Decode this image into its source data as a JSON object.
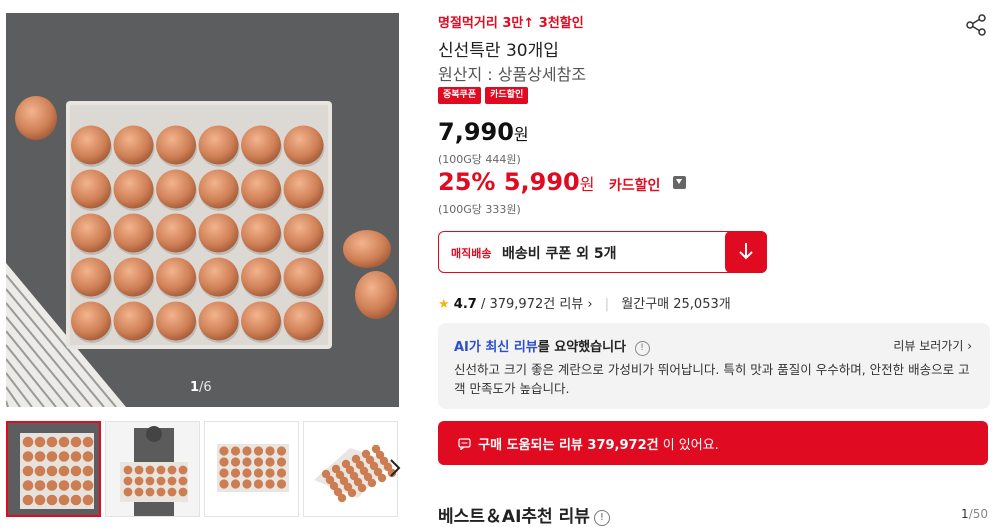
{
  "gallery": {
    "pager_current": "1",
    "pager_total": "/6",
    "next_icon": "chevron-right-icon"
  },
  "product": {
    "promo_text": "명절먹거리 3만",
    "promo_arrow": "↑",
    "promo_text2": "3천할인",
    "title": "신선특란 30개입",
    "origin": "원산지 : 상품상세참조",
    "badges": [
      "중복쿠폰",
      "카드할인"
    ],
    "price": "7,990",
    "price_unit": "원",
    "unit_price": "(100G당 444원)",
    "discount_rate": "25%",
    "sale_price": "5,990",
    "sale_unit": "원",
    "sale_label": "카드할인",
    "sale_unit_price": "(100G당 333원)"
  },
  "shipping": {
    "tag": "매직배송",
    "text": "배송비 쿠폰 외 5개",
    "button_icon": "arrow-down-icon"
  },
  "rating": {
    "score": "4.7",
    "reviews": "/ 379,972건 리뷰",
    "monthly": "월간구매 25,053개"
  },
  "ai_summary": {
    "head_blue": "AI가 최신 리뷰",
    "head_rest": "를 요약했습니다",
    "more": "리뷰 보러가기",
    "body": "신선하고 크기 좋은 계란으로 가성비가 뛰어납니다. 특히 맛과 품질이 우수하며, 안전한 배송으로 고객 만족도가 높습니다."
  },
  "helpful": {
    "icon": "chat-icon",
    "bold": "구매 도움되는 리뷰 379,972건",
    "rest": " 이 있어요."
  },
  "best_reviews": {
    "title": "베스트＆AI추천 리뷰",
    "page_current": "1",
    "page_total": "/50"
  },
  "colors": {
    "accent": "#e00b20",
    "ai_blue": "#2b4ecf",
    "star": "#f0b619"
  }
}
